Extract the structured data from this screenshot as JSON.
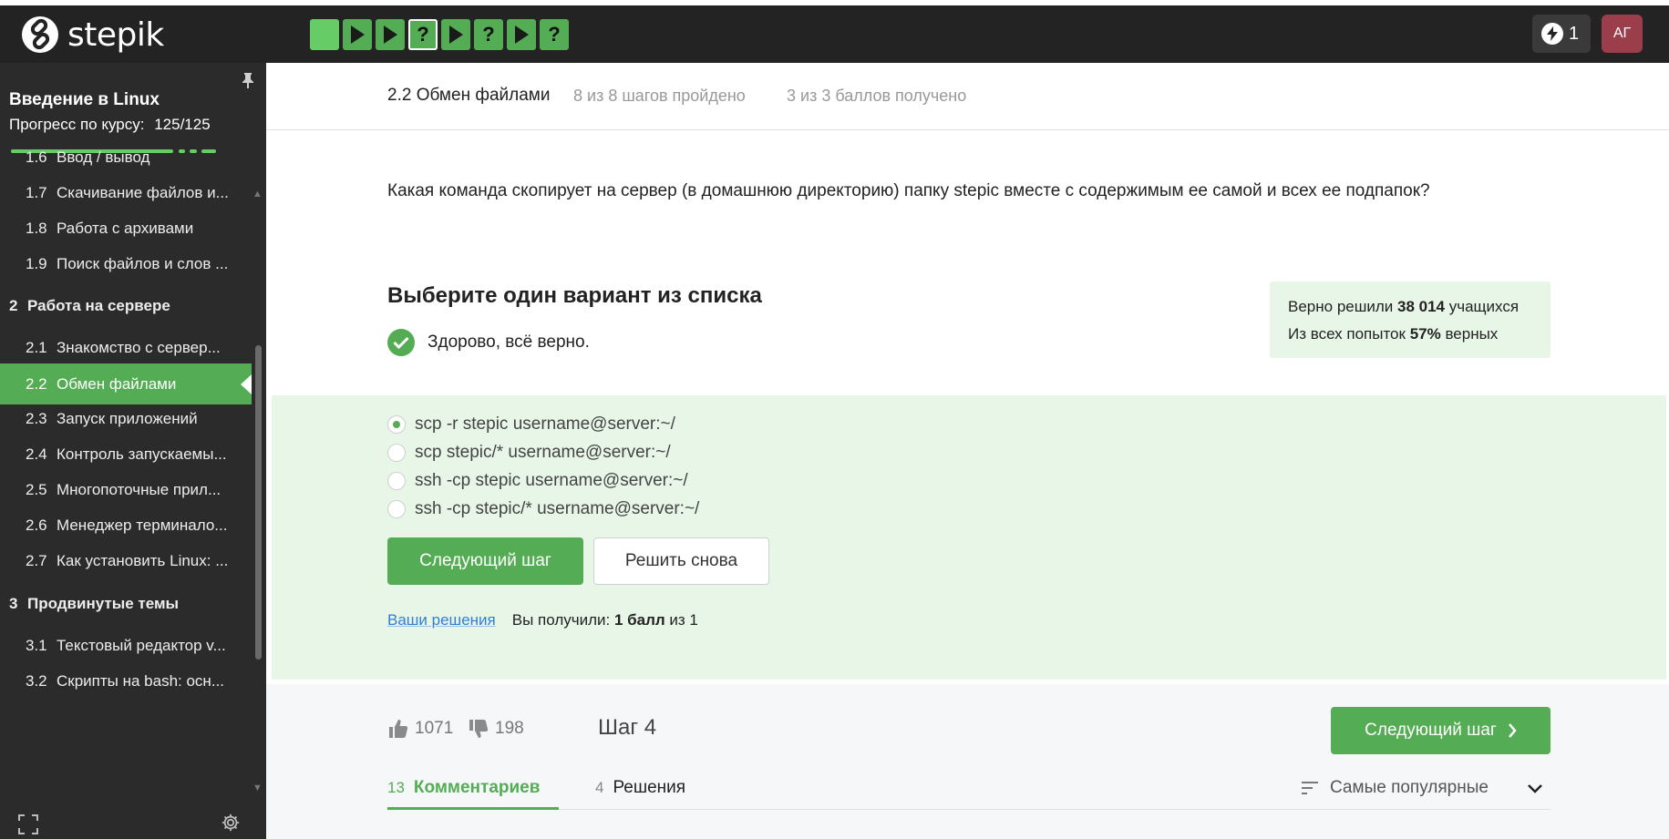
{
  "app": {
    "logo_text": "stepik",
    "energy_count": "1",
    "avatar_initials": "АГ"
  },
  "steps_bar": [
    {
      "kind": "video",
      "state": "done"
    },
    {
      "kind": "play",
      "state": "done"
    },
    {
      "kind": "play",
      "state": "done"
    },
    {
      "kind": "question",
      "state": "current",
      "label": "?"
    },
    {
      "kind": "play",
      "state": "done"
    },
    {
      "kind": "question",
      "state": "done",
      "label": "?"
    },
    {
      "kind": "play",
      "state": "done"
    },
    {
      "kind": "question",
      "state": "done",
      "label": "?"
    }
  ],
  "sidebar": {
    "course_title": "Введение в Linux",
    "progress_label": "Прогресс по курсу:",
    "progress_value": "125/125",
    "progress_fraction": 1.0,
    "items": [
      {
        "num": "1.6",
        "label": "Ввод / вывод",
        "type": "lesson"
      },
      {
        "num": "1.7",
        "label": "Скачивание файлов и...",
        "type": "lesson"
      },
      {
        "num": "1.8",
        "label": "Работа с архивами",
        "type": "lesson"
      },
      {
        "num": "1.9",
        "label": "Поиск файлов и слов ...",
        "type": "lesson"
      },
      {
        "num": "2",
        "label": "Работа на сервере",
        "type": "section"
      },
      {
        "num": "2.1",
        "label": "Знакомство с сервер...",
        "type": "lesson"
      },
      {
        "num": "2.2",
        "label": "Обмен файлами",
        "type": "lesson",
        "active": true
      },
      {
        "num": "2.3",
        "label": "Запуск приложений",
        "type": "lesson"
      },
      {
        "num": "2.4",
        "label": "Контроль запускаемы...",
        "type": "lesson"
      },
      {
        "num": "2.5",
        "label": "Многопоточные прил...",
        "type": "lesson"
      },
      {
        "num": "2.6",
        "label": "Менеджер терминало...",
        "type": "lesson"
      },
      {
        "num": "2.7",
        "label": "Как установить Linux: ...",
        "type": "lesson"
      },
      {
        "num": "3",
        "label": "Продвинутые темы",
        "type": "section"
      },
      {
        "num": "3.1",
        "label": "Текстовый редактор v...",
        "type": "lesson"
      },
      {
        "num": "3.2",
        "label": "Скрипты на bash: осн...",
        "type": "lesson"
      }
    ]
  },
  "lesson": {
    "title": "2.2 Обмен файлами",
    "steps_done": "8 из 8 шагов пройдено",
    "score": "3 из 3 баллов  получено"
  },
  "question": {
    "text": "Какая команда скопирует на сервер (в домашнюю директорию) папку stepic вместе с содержимым ее самой и всех ее подпапок?",
    "instruction": "Выберите один вариант из списка",
    "feedback": "Здорово, всё верно.",
    "stats_line1_pre": "Верно решили ",
    "stats_line1_num": "38 014",
    "stats_line1_post": " учащихся",
    "stats_line2_pre": "Из всех попыток ",
    "stats_line2_num": "57%",
    "stats_line2_post": " верных",
    "options": [
      {
        "label": "scp -r stepic username@server:~/",
        "selected": true
      },
      {
        "label": "scp stepic/* username@server:~/",
        "selected": false
      },
      {
        "label": "ssh -cp stepic username@server:~/",
        "selected": false
      },
      {
        "label": "ssh -cp stepic/* username@server:~/",
        "selected": false
      }
    ],
    "next_button": "Следующий шаг",
    "retry_button": "Решить снова",
    "solutions_link": "Ваши решения",
    "received_pre": "Вы получили: ",
    "received_bold": "1 балл",
    "received_post": " из 1"
  },
  "footer": {
    "likes": "1071",
    "dislikes": "198",
    "step_label": "Шаг 4",
    "next_button": "Следующий шаг",
    "tabs": [
      {
        "count": "13",
        "label": "Комментариев",
        "active": true
      },
      {
        "count": "4",
        "label": "Решения",
        "active": false
      }
    ],
    "sort_label": "Самые популярные"
  },
  "colors": {
    "accent_green": "#54ad54",
    "topbar": "#232323",
    "sidebar": "#2b2b2b",
    "answer_bg": "#e8f6e8",
    "avatar": "#9b3d4b"
  }
}
